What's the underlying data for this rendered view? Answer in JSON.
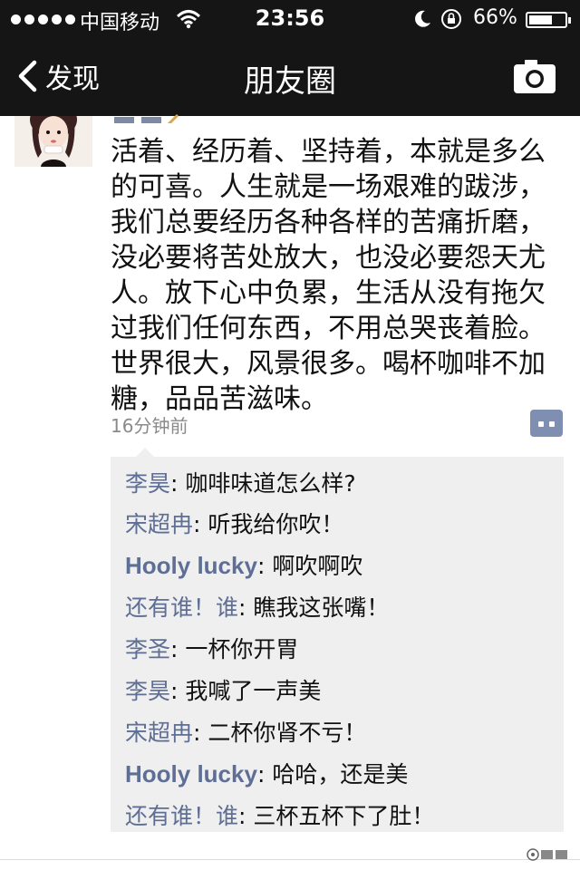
{
  "status_bar": {
    "carrier": "中国移动",
    "time": "23:56",
    "battery_percent": "66%",
    "battery_level": 0.66
  },
  "nav": {
    "back_label": "发现",
    "title": "朋友圈"
  },
  "post": {
    "lines": [
      "活着、经历着、坚持着，本就是多么",
      "的可喜。人生就是一场艰难的跋涉，",
      "我们总要经历各种各样的苦痛折磨，",
      "没必要将苦处放大，也没必要怨天尤",
      "人。放下心中负累，生活从没有拖欠",
      "过我们任何东西，不用总哭丧着脸。",
      "世界很大，风景很多。喝杯咖啡不加",
      "糖，品品苦滋味。"
    ],
    "time_ago": "16分钟前"
  },
  "comments": [
    {
      "name": "李昊",
      "sep": ": ",
      "text": "咖啡味道怎么样?"
    },
    {
      "name": "宋超冉",
      "sep": ": ",
      "text": "听我给你吹！"
    },
    {
      "name": "Hooly lucky",
      "sep": ": ",
      "text": "啊吹啊吹"
    },
    {
      "name": "还有谁！谁",
      "sep": ": ",
      "text": "瞧我这张嘴！"
    },
    {
      "name": "李圣",
      "sep": ": ",
      "text": "一杯你开胃"
    },
    {
      "name": "李昊",
      "sep": ": ",
      "text": "我喊了一声美"
    },
    {
      "name": "宋超冉",
      "sep": ": ",
      "text": "二杯你肾不亏！"
    },
    {
      "name": "Hooly lucky",
      "sep": ": ",
      "text": "哈哈，还是美"
    },
    {
      "name": "还有谁！谁",
      "sep": ": ",
      "text": "三杯五杯下了肚！"
    }
  ],
  "colors": {
    "bar_background": "#151515",
    "name_color": "#5e6e95",
    "comment_background": "#efefef",
    "comment_button": "#7e8fb1"
  }
}
